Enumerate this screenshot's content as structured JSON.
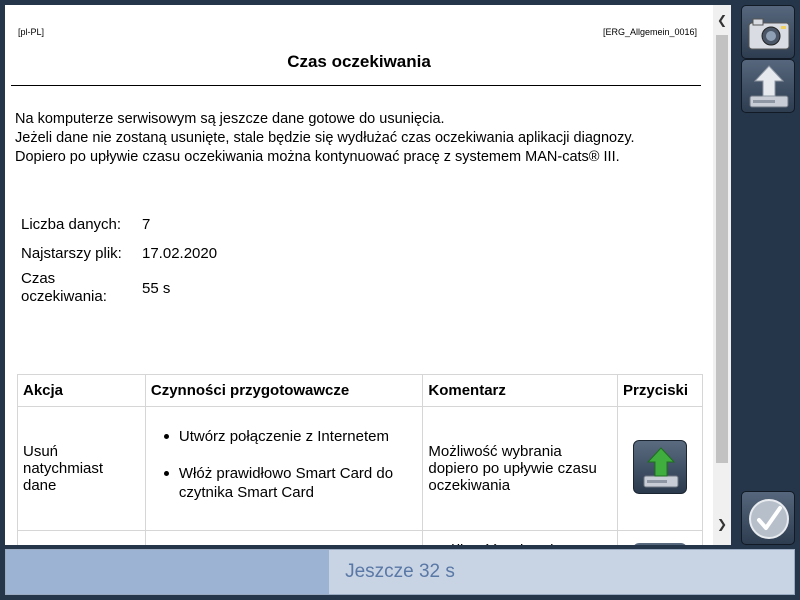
{
  "header": {
    "language": "[pl-PL]",
    "doc_id": "[ERG_Allgemein_0016]",
    "title": "Czas oczekiwania"
  },
  "intro": [
    "Na komputerze serwisowym są jeszcze dane gotowe do usunięcia.",
    "Jeżeli dane nie zostaną usunięte, stale będzie się wydłużać czas oczekiwania aplikacji diagnozy.",
    "Dopiero po upływie czasu oczekiwania można kontynuować pracę z systemem MAN-cats® III."
  ],
  "facts": [
    {
      "label": "Liczba danych:",
      "value": "7"
    },
    {
      "label": "Najstarszy plik:",
      "value": "17.02.2020"
    },
    {
      "label": "Czas oczekiwania:",
      "value": "55 s"
    }
  ],
  "table": {
    "headers": [
      "Akcja",
      "Czynności przygotowawcze",
      "Komentarz",
      "Przyciski"
    ],
    "rows": [
      {
        "action": "Usuń natychmiast dane",
        "prep": [
          "Utwórz połączenie z Internetem",
          "Włóż prawidłowo Smart Card do czytnika Smart Card"
        ],
        "comment": "Możliwość wybrania dopiero po upływie czasu oczekiwania",
        "button_icon": "upload-drive-icon"
      },
      {
        "action": "",
        "prep": [],
        "comment": "Możliwość wybrania",
        "button_icon": "upload-drive-icon"
      }
    ]
  },
  "status": {
    "text": "Jeszcze 32 s",
    "progress": 0.41
  },
  "icons": {
    "side_top": "camera-icon",
    "side_second": "upload-drive-icon",
    "side_bottom": "checkmark-icon"
  },
  "colors": {
    "background": "#25354a",
    "status_bar": "#c8d4e4",
    "progress_fill": "#9db3d3",
    "status_text": "#5a78a6",
    "upload_arrow": "#3fae3f"
  }
}
